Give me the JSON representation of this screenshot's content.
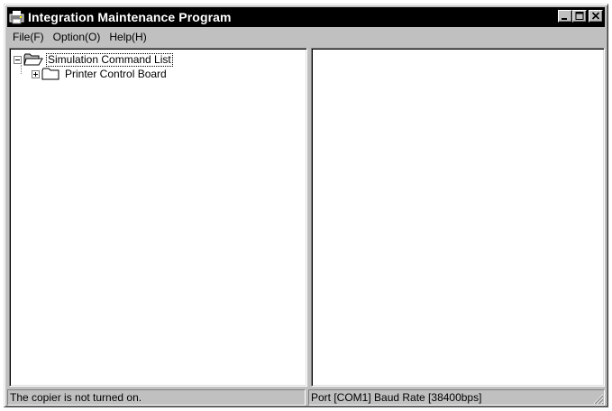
{
  "window": {
    "title": "Integration Maintenance Program",
    "app_icon": "printer-app-icon",
    "buttons": [
      "minimize-icon",
      "maximize-icon",
      "close-icon"
    ]
  },
  "menu": {
    "file": "File(F)",
    "option": "Option(O)",
    "help": "Help(H)"
  },
  "tree": {
    "root_label": "Simulation Command List",
    "root_expander": "minus",
    "child_label": "Printer Control Board",
    "child_expander": "plus"
  },
  "status": {
    "left": "The copier is not turned on.",
    "right": "Port [COM1] Baud Rate [38400bps]"
  },
  "colors": {
    "face": "#c0c0c0",
    "titlebar": "#000000",
    "pane": "#ffffff"
  }
}
